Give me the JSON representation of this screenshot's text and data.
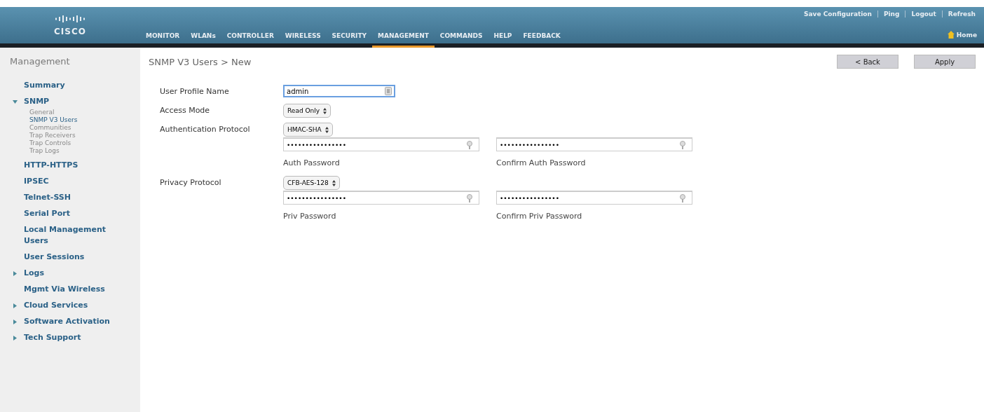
{
  "header": {
    "logo": "CISCO",
    "links": [
      "Save Configuration",
      "Ping",
      "Logout",
      "Refresh"
    ],
    "home": "Home",
    "nav": [
      {
        "label": "MONITOR",
        "selected": false
      },
      {
        "label": "WLANs",
        "selected": false
      },
      {
        "label": "CONTROLLER",
        "selected": false
      },
      {
        "label": "WIRELESS",
        "selected": false
      },
      {
        "label": "SECURITY",
        "selected": false
      },
      {
        "label": "MANAGEMENT",
        "selected": true
      },
      {
        "label": "COMMANDS",
        "selected": false
      },
      {
        "label": "HELP",
        "selected": false
      },
      {
        "label": "FEEDBACK",
        "selected": false
      }
    ]
  },
  "sidebar": {
    "title": "Management",
    "items": [
      {
        "label": "Summary",
        "kind": "link"
      },
      {
        "label": "SNMP",
        "kind": "folder",
        "expanded": true,
        "children": [
          {
            "label": "General",
            "selected": false
          },
          {
            "label": "SNMP V3 Users",
            "selected": true
          },
          {
            "label": "Communities",
            "selected": false
          },
          {
            "label": "Trap Receivers",
            "selected": false
          },
          {
            "label": "Trap Controls",
            "selected": false
          },
          {
            "label": "Trap Logs",
            "selected": false
          }
        ]
      },
      {
        "label": "HTTP-HTTPS",
        "kind": "link"
      },
      {
        "label": "IPSEC",
        "kind": "link"
      },
      {
        "label": "Telnet-SSH",
        "kind": "link"
      },
      {
        "label": "Serial Port",
        "kind": "link"
      },
      {
        "label": "Local Management Users",
        "kind": "link"
      },
      {
        "label": "User Sessions",
        "kind": "link"
      },
      {
        "label": "Logs",
        "kind": "folder",
        "expanded": false
      },
      {
        "label": "Mgmt Via Wireless",
        "kind": "link"
      },
      {
        "label": "Cloud Services",
        "kind": "folder",
        "expanded": false
      },
      {
        "label": "Software Activation",
        "kind": "folder",
        "expanded": false
      },
      {
        "label": "Tech Support",
        "kind": "folder",
        "expanded": false
      }
    ]
  },
  "page": {
    "breadcrumb": "SNMP V3 Users > New",
    "buttons": [
      "< Back",
      "Apply"
    ],
    "rows": [
      {
        "kind": "text",
        "label": "User Profile Name",
        "value": "admin",
        "focused": true
      },
      {
        "kind": "select",
        "label": "Access Mode",
        "value": "Read Only"
      },
      {
        "kind": "select",
        "label": "Authentication Protocol",
        "value": "HMAC-SHA"
      },
      {
        "kind": "passwords",
        "fields": [
          {
            "value": "••••••••••••••••",
            "caption": "Auth Password"
          },
          {
            "value": "••••••••••••••••",
            "caption": "Confirm Auth Password"
          }
        ]
      },
      {
        "kind": "select",
        "label": "Privacy Protocol",
        "value": "CFB-AES-128"
      },
      {
        "kind": "passwords",
        "fields": [
          {
            "value": "••••••••••••••••",
            "caption": "Priv Password"
          },
          {
            "value": "••••••••••••••••",
            "caption": "Confirm Priv Password"
          }
        ]
      }
    ]
  }
}
